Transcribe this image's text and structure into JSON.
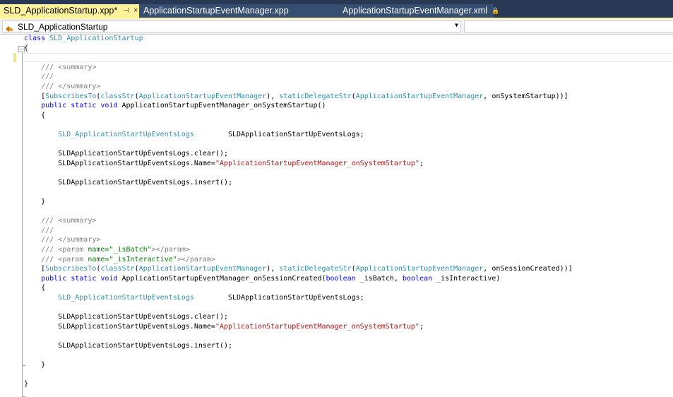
{
  "tabs": [
    {
      "label": "SLD_ApplicationStartup.xpp*",
      "active": true,
      "pin_glyph": "⊣",
      "close_glyph": "×"
    },
    {
      "label": "ApplicationStartupEventManager.xpp",
      "active": false
    },
    {
      "label": "ApplicationStartupEventManager.xml",
      "active": false,
      "lock_glyph": "🔒"
    }
  ],
  "navbar": {
    "class_combo_value": "SLD_ApplicationStartup",
    "dropdown_glyph": "▼",
    "member_combo_value": ""
  },
  "editor": {
    "outline_collapse_glyph": "−",
    "lines": [
      "class SLD_ApplicationStartup",
      "{",
      "",
      "    /// <summary>",
      "    ///",
      "    /// </summary>",
      "    [SubscribesTo(classStr(ApplicationStartupEventManager), staticDelegateStr(ApplicationStartupEventManager, onSystemStartup))]",
      "    public static void ApplicationStartupEventManager_onSystemStartup()",
      "    {",
      "",
      "        SLD_ApplicationStartUpEventsLogs        SLDApplicationStartUpEventsLogs;",
      "",
      "        SLDApplicationStartUpEventsLogs.clear();",
      "        SLDApplicationStartUpEventsLogs.Name=\"ApplicationStartupEventManager_onSystemStartup\";",
      "",
      "        SLDApplicationStartUpEventsLogs.insert();",
      "",
      "    }",
      "",
      "    /// <summary>",
      "    ///",
      "    /// </summary>",
      "    /// <param name=\"_isBatch\"></param>",
      "    /// <param name=\"_isInteractive\"></param>",
      "    [SubscribesTo(classStr(ApplicationStartupEventManager), staticDelegateStr(ApplicationStartupEventManager, onSessionCreated))]",
      "    public static void ApplicationStartupEventManager_onSessionCreated(boolean _isBatch, boolean _isInteractive)",
      "    {",
      "        SLD_ApplicationStartUpEventsLogs        SLDApplicationStartUpEventsLogs;",
      "",
      "        SLDApplicationStartUpEventsLogs.clear();",
      "        SLDApplicationStartUpEventsLogs.Name=\"ApplicationStartupEventManager_onSystemStartup\";",
      "",
      "        SLDApplicationStartUpEventsLogs.insert();",
      "",
      "    }",
      "",
      "}"
    ]
  },
  "colors": {
    "tabstrip_bg": "#293955",
    "active_tab": "#fff29d",
    "keyword": "#0000ff",
    "type": "#2b91af",
    "comment": "#008000",
    "string": "#a31515"
  }
}
